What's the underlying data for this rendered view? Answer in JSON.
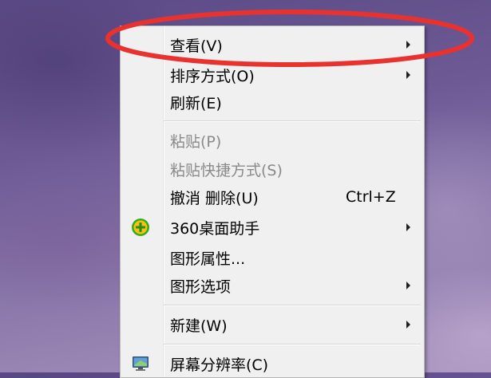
{
  "context_menu": {
    "items": [
      {
        "label": "查看(V)",
        "submenu": true,
        "enabled": true
      },
      {
        "label": "排序方式(O)",
        "submenu": true,
        "enabled": true
      },
      {
        "label": "刷新(E)",
        "submenu": false,
        "enabled": true
      },
      {
        "label": "粘贴(P)",
        "submenu": false,
        "enabled": false
      },
      {
        "label": "粘贴快捷方式(S)",
        "submenu": false,
        "enabled": false
      },
      {
        "label": "撤消 删除(U)",
        "shortcut": "Ctrl+Z",
        "submenu": false,
        "enabled": true
      },
      {
        "label": "360桌面助手",
        "submenu": true,
        "enabled": true,
        "icon": "360-assistant-icon"
      },
      {
        "label": "图形属性...",
        "submenu": false,
        "enabled": true
      },
      {
        "label": "图形选项",
        "submenu": true,
        "enabled": true
      },
      {
        "label": "新建(W)",
        "submenu": true,
        "enabled": true
      },
      {
        "label": "屏幕分辨率(C)",
        "submenu": false,
        "enabled": true,
        "icon": "display-icon"
      }
    ]
  },
  "annotation": {
    "shape": "ellipse",
    "color": "#e8322f",
    "target": "查看(V)"
  },
  "colors": {
    "menu_bg": "#f0f0f0",
    "disabled_text": "#8a8a8a",
    "icon_360_green": "#3aa81f",
    "icon_360_yellow": "#f2c40c"
  }
}
